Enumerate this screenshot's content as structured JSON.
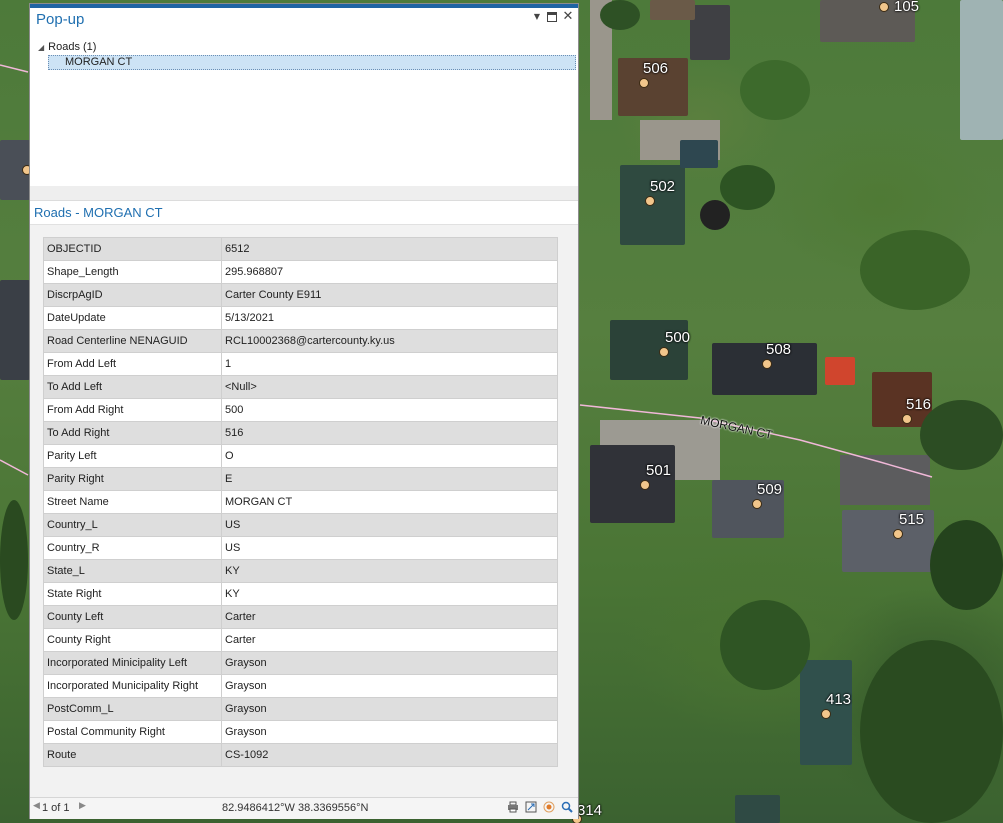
{
  "popup": {
    "title": "Pop-up",
    "controls": {
      "pin_icon": "chevron-down-icon",
      "restore_icon": "restore-icon",
      "close_icon": "close-icon"
    },
    "tree": {
      "group_label": "Roads  (1)",
      "selected_item": "MORGAN CT"
    },
    "feature_heading": "Roads - MORGAN CT",
    "attributes": [
      {
        "field": "OBJECTID",
        "value": "6512"
      },
      {
        "field": "Shape_Length",
        "value": "295.968807"
      },
      {
        "field": "DiscrpAgID",
        "value": "Carter County E911"
      },
      {
        "field": "DateUpdate",
        "value": "5/13/2021"
      },
      {
        "field": "Road Centerline NENAGUID",
        "value": "RCL10002368@cartercounty.ky.us"
      },
      {
        "field": "From Add Left",
        "value": "1"
      },
      {
        "field": "To Add Left",
        "value": "<Null>"
      },
      {
        "field": "From Add Right",
        "value": "500"
      },
      {
        "field": "To Add Right",
        "value": "516"
      },
      {
        "field": "Parity Left",
        "value": "O"
      },
      {
        "field": "Parity Right",
        "value": "E"
      },
      {
        "field": "Street Name",
        "value": "MORGAN CT"
      },
      {
        "field": "Country_L",
        "value": "US"
      },
      {
        "field": "Country_R",
        "value": "US"
      },
      {
        "field": "State_L",
        "value": "KY"
      },
      {
        "field": "State Right",
        "value": "KY"
      },
      {
        "field": "County Left",
        "value": "Carter"
      },
      {
        "field": "County Right",
        "value": "Carter"
      },
      {
        "field": "Incorporated Minicipality Left",
        "value": "Grayson"
      },
      {
        "field": "Incorporated Municipality Right",
        "value": "Grayson"
      },
      {
        "field": "PostComm_L",
        "value": "Grayson"
      },
      {
        "field": "Postal Community Right",
        "value": "Grayson"
      },
      {
        "field": "Route",
        "value": "CS-1092"
      }
    ],
    "footer": {
      "page_counter": "1 of 1",
      "coordinates": "82.9486412°W 38.3369556°N",
      "icons": [
        "print-icon",
        "export-icon",
        "flash-icon",
        "zoom-to-icon"
      ]
    }
  },
  "map": {
    "road_label": "MORGAN CT",
    "address_labels": [
      "105",
      "506",
      "502",
      "500",
      "508",
      "516",
      "501",
      "509",
      "515",
      "413",
      "314"
    ],
    "colors": {
      "address_point": "#f2c68b",
      "road_line": "#f0b8d8",
      "accent": "#1f6fb0"
    }
  }
}
